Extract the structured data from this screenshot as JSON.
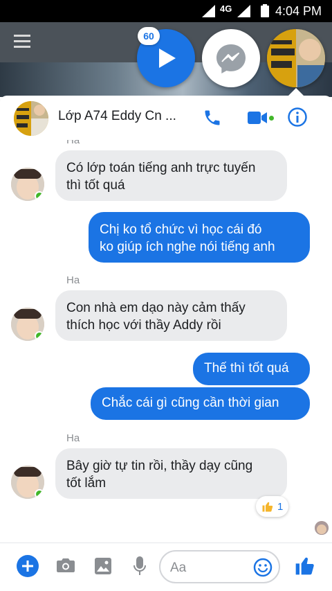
{
  "status_bar": {
    "network": "4G",
    "time": "4:04 PM"
  },
  "chat_heads": {
    "video_badge": "60"
  },
  "chat": {
    "title": "Lớp A74 Eddy Cn ...",
    "colors": {
      "accent": "#1b74e4",
      "incoming_bubble": "#eaebed",
      "online": "#42b72a"
    },
    "messages": [
      {
        "sender": "Ha",
        "text_1": "Có lớp toán tiếng anh trực tuyến",
        "text_2": "thì tốt quá"
      },
      {
        "sender": "me",
        "text_1": "Chị ko tổ chức vì học cái đó",
        "text_2": "ko giúp ích nghe nói tiếng anh"
      },
      {
        "sender": "Ha",
        "text_1": "Con nhà em dạo này cảm thấy",
        "text_2": "thích học với thầy Addy rồi"
      },
      {
        "sender": "me",
        "text_1": "Thế thì tốt quá"
      },
      {
        "sender": "me",
        "text_1": "Chắc cái gì cũng cần thời gian"
      },
      {
        "sender": "Ha",
        "text_1": "Bây giờ tự tin rồi, thầy dạy cũng",
        "text_2": "tốt lắm"
      }
    ],
    "reaction": {
      "icon": "thumbs-up",
      "count": "1"
    }
  },
  "composer": {
    "placeholder": "Aa"
  }
}
